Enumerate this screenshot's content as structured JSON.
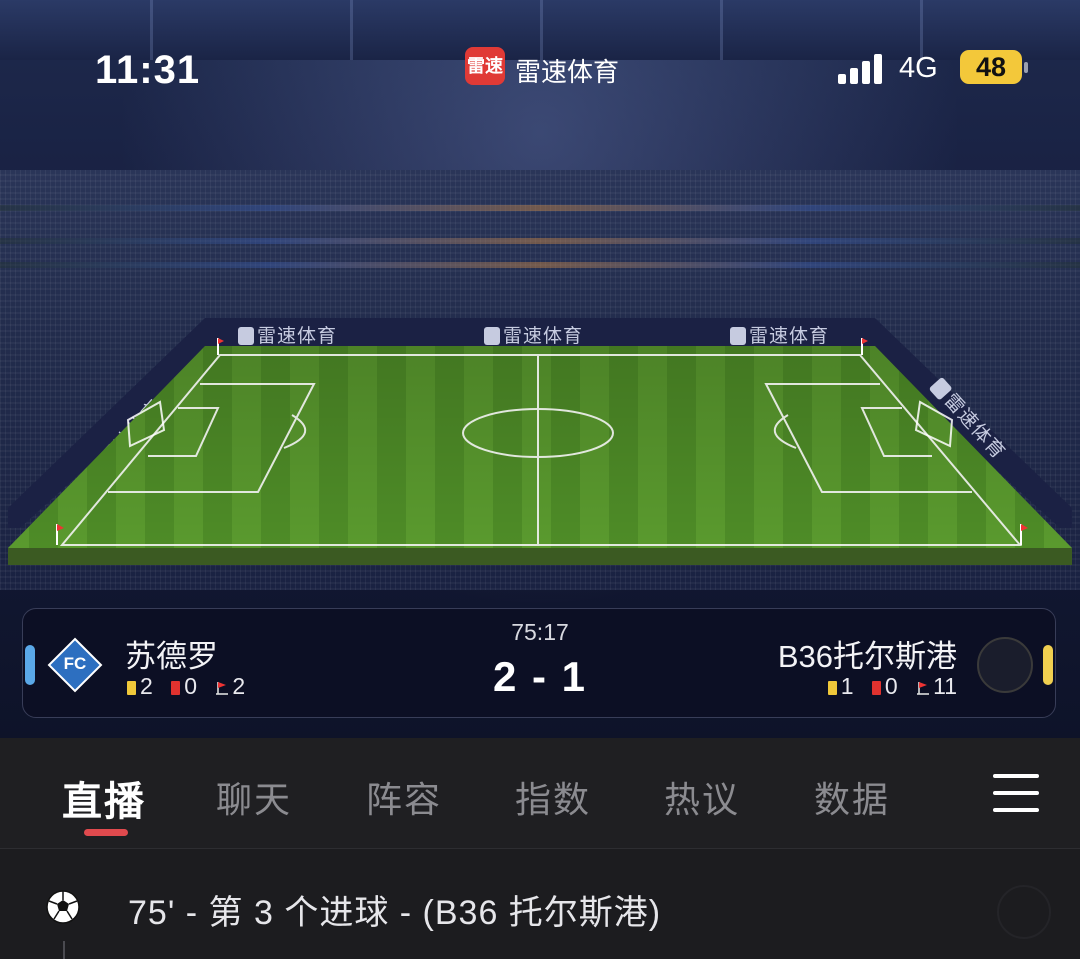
{
  "status_bar": {
    "time": "11:31",
    "app_logo_text": "雷速",
    "app_name": "雷速体育",
    "network": "4G",
    "battery": "48"
  },
  "stadium": {
    "ad_text": "雷速体育"
  },
  "match": {
    "clock": "75:17",
    "score": "2 - 1",
    "home": {
      "name": "苏德罗",
      "logo_text": "FC",
      "yellow_cards": "2",
      "red_cards": "0",
      "corners": "2",
      "color": "#5aa8e8"
    },
    "away": {
      "name": "B36托尔斯港",
      "yellow_cards": "1",
      "red_cards": "0",
      "corners": "11",
      "color": "#f0cf50"
    }
  },
  "tabs": [
    {
      "label": "直播",
      "active": true
    },
    {
      "label": "聊天"
    },
    {
      "label": "阵容"
    },
    {
      "label": "指数"
    },
    {
      "label": "热议"
    },
    {
      "label": "数据"
    }
  ],
  "feed": {
    "events": [
      {
        "icon": "soccer-ball-icon",
        "text": "75' - 第 3 个进球 - (B36 托尔斯港)"
      }
    ]
  },
  "colors": {
    "accent_red": "#e04a4e",
    "tab_bg": "#1f1f22",
    "card_bg": "#0c0f24"
  }
}
